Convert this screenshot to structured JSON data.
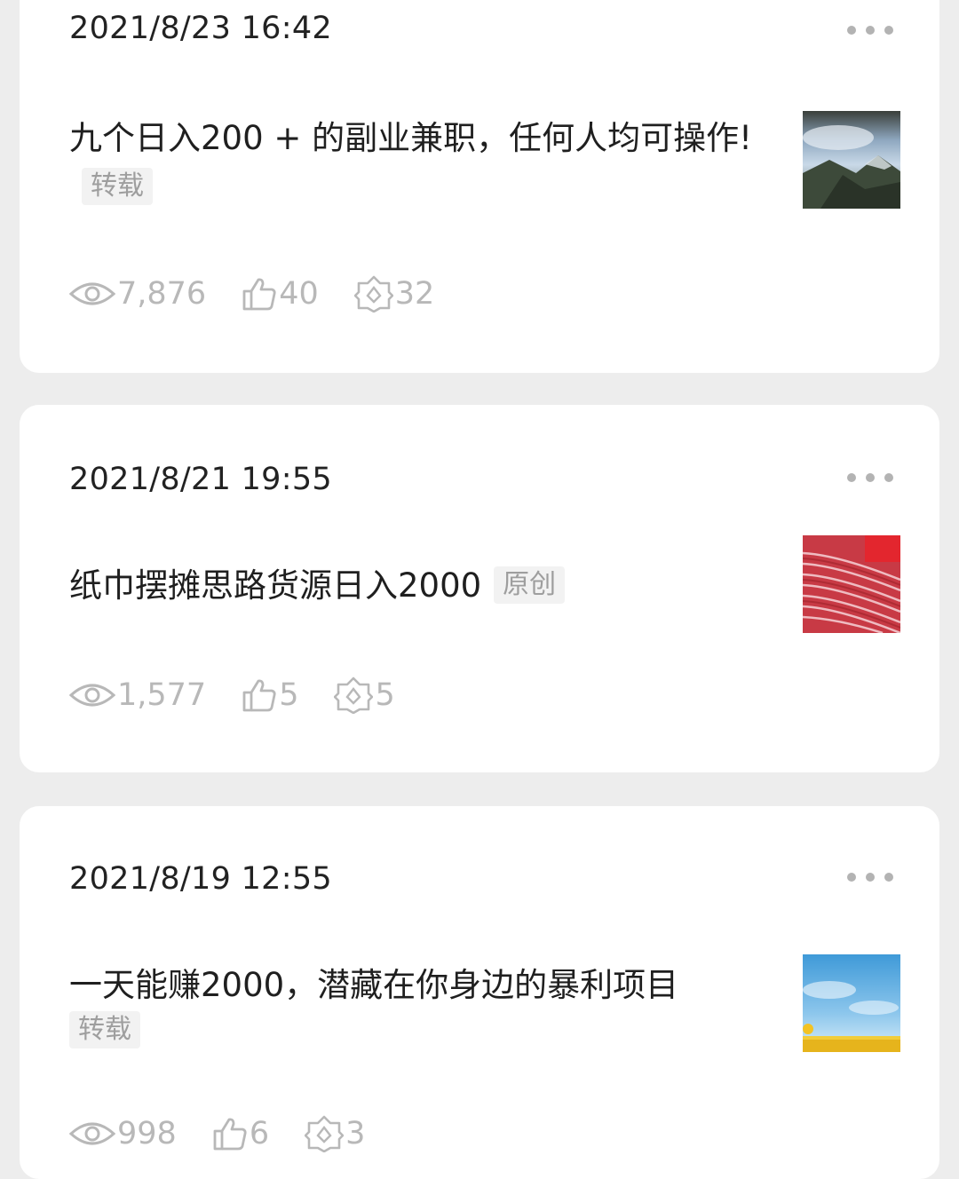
{
  "posts": [
    {
      "date": "2021/8/23 16:42",
      "title": "九个日入200 + 的副业兼职，任何人均可操作!",
      "tag": "转载",
      "views": "7,876",
      "likes": "40",
      "shares": "32",
      "thumbnail": "mountain-landscape"
    },
    {
      "date": "2021/8/21 19:55",
      "title": "纸巾摆摊思路货源日入2000",
      "tag": "原创",
      "views": "1,577",
      "likes": "5",
      "shares": "5",
      "thumbnail": "red-paper-stack"
    },
    {
      "date": "2021/8/19 12:55",
      "title": "一天能赚2000，潜藏在你身边的暴利项目",
      "tag": "转载",
      "views": "998",
      "likes": "6",
      "shares": "3",
      "thumbnail": "sky-field"
    }
  ],
  "icons": {
    "views": "eye-icon",
    "likes": "thumbs-up-icon",
    "shares": "share-icon",
    "more": "more-dots-icon"
  },
  "colors": {
    "background": "#ededed",
    "card": "#ffffff",
    "stat_gray": "#b8b8b8",
    "tag_bg": "#f2f2f2"
  }
}
